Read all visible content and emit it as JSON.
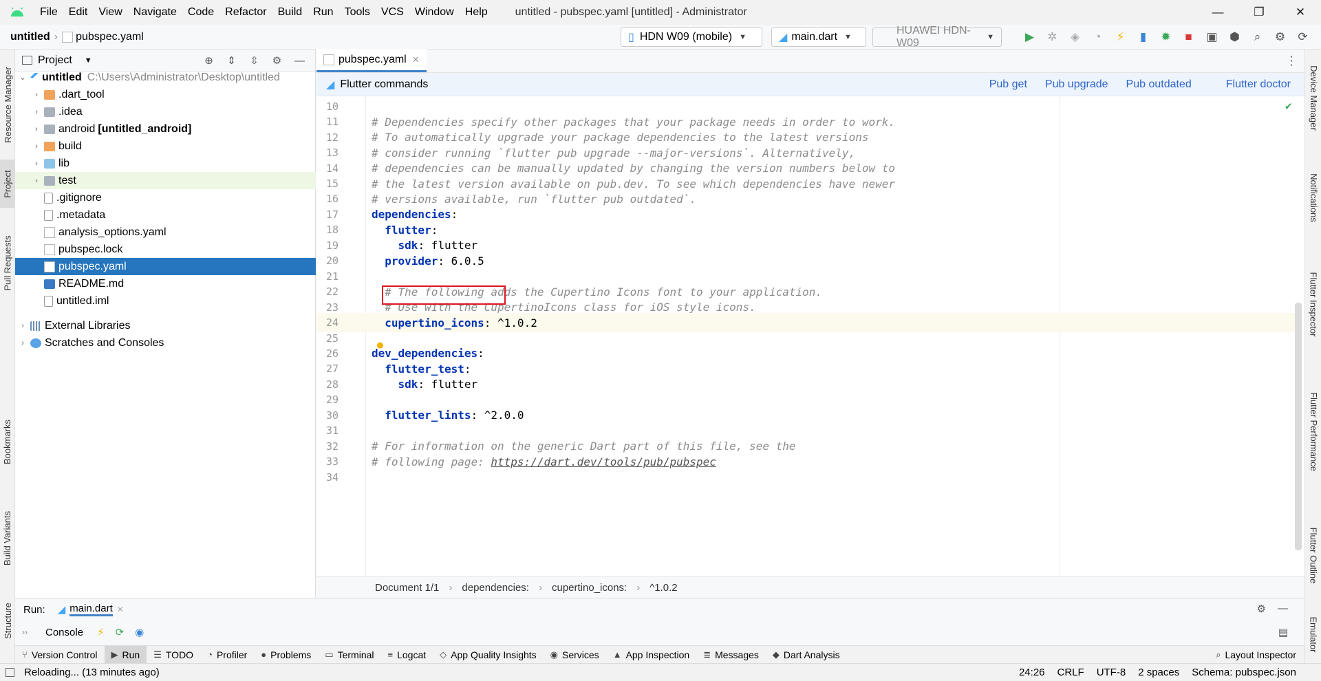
{
  "titlebar": {
    "menu": [
      "File",
      "Edit",
      "View",
      "Navigate",
      "Code",
      "Refactor",
      "Build",
      "Run",
      "Tools",
      "VCS",
      "Window",
      "Help"
    ],
    "window_title": "untitled - pubspec.yaml [untitled] - Administrator",
    "minimize": "—",
    "restore": "❐",
    "close": "✕"
  },
  "navbar": {
    "project": "untitled",
    "file": "pubspec.yaml",
    "device": "HDN W09 (mobile)",
    "run_config": "main.dart",
    "device2": "HUAWEI HDN-W09"
  },
  "project_panel": {
    "title": "Project",
    "root": {
      "name": "untitled",
      "path": "C:\\Users\\Administrator\\Desktop\\untitled"
    },
    "items": [
      {
        "name": ".dart_tool",
        "icon": "folder-orange",
        "chev": true
      },
      {
        "name": ".idea",
        "icon": "folder-gray",
        "chev": true
      },
      {
        "name": "android",
        "suffix": "[untitled_android]",
        "icon": "folder-gray",
        "chev": true
      },
      {
        "name": "build",
        "icon": "folder-orange",
        "chev": true
      },
      {
        "name": "lib",
        "icon": "folder-blue",
        "chev": true
      },
      {
        "name": "test",
        "icon": "folder-gray",
        "chev": true
      },
      {
        "name": ".gitignore",
        "icon": "file",
        "chev": false
      },
      {
        "name": ".metadata",
        "icon": "file",
        "chev": false
      },
      {
        "name": "analysis_options.yaml",
        "icon": "yml",
        "chev": false
      },
      {
        "name": "pubspec.lock",
        "icon": "yml",
        "chev": false
      },
      {
        "name": "pubspec.yaml",
        "icon": "yml",
        "chev": false
      },
      {
        "name": "README.md",
        "icon": "md",
        "chev": false
      },
      {
        "name": "untitled.iml",
        "icon": "file",
        "chev": false
      }
    ],
    "external": "External Libraries",
    "scratches": "Scratches and Consoles"
  },
  "editor": {
    "tab": "pubspec.yaml",
    "flutter_commands": "Flutter commands",
    "links": [
      "Pub get",
      "Pub upgrade",
      "Pub outdated",
      "Flutter doctor"
    ],
    "lines": [
      {
        "n": "10",
        "t": ""
      },
      {
        "n": "11",
        "t": "# Dependencies specify other packages that your package needs in order to work."
      },
      {
        "n": "12",
        "t": "# To automatically upgrade your package dependencies to the latest versions"
      },
      {
        "n": "13",
        "t": "# consider running `flutter pub upgrade --major-versions`. Alternatively,"
      },
      {
        "n": "14",
        "t": "# dependencies can be manually updated by changing the version numbers below to"
      },
      {
        "n": "15",
        "t": "# the latest version available on pub.dev. To see which dependencies have newer"
      },
      {
        "n": "16",
        "t": "# versions available, run `flutter pub outdated`."
      },
      {
        "n": "17",
        "k": "dependencies",
        "v": ":"
      },
      {
        "n": "18",
        "k": "  flutter",
        "v": ":"
      },
      {
        "n": "19",
        "k": "    sdk",
        "v": ": flutter"
      },
      {
        "n": "20",
        "k": "  provider",
        "v": ": 6.0.5"
      },
      {
        "n": "21",
        "t": ""
      },
      {
        "n": "22",
        "t": "  # The following adds the Cupertino Icons font to your application."
      },
      {
        "n": "23",
        "t": "  # Use with the CupertinoIcons class for iOS style icons."
      },
      {
        "n": "24",
        "k": "  cupertino_icons",
        "v": ": ^1.0.2"
      },
      {
        "n": "25",
        "t": ""
      },
      {
        "n": "26",
        "k": "dev_dependencies",
        "v": ":"
      },
      {
        "n": "27",
        "k": "  flutter_test",
        "v": ":"
      },
      {
        "n": "28",
        "k": "    sdk",
        "v": ": flutter"
      },
      {
        "n": "29",
        "t": ""
      },
      {
        "n": "30",
        "k": "  flutter_lints",
        "v": ": ^2.0.0"
      },
      {
        "n": "31",
        "t": ""
      },
      {
        "n": "32",
        "t": "# For information on the generic Dart part of this file, see the"
      },
      {
        "n": "33",
        "t": "# following page: ",
        "u": "https://dart.dev/tools/pub/pubspec"
      },
      {
        "n": "34",
        "t": ""
      }
    ],
    "breadcrumb": [
      "Document 1/1",
      "dependencies:",
      "cupertino_icons:",
      "^1.0.2"
    ]
  },
  "run_panel": {
    "label": "Run:",
    "tab": "main.dart",
    "console": "Console"
  },
  "tool_tabs": [
    "Version Control",
    "Run",
    "TODO",
    "Profiler",
    "Problems",
    "Terminal",
    "Logcat",
    "App Quality Insights",
    "Services",
    "App Inspection",
    "Messages",
    "Dart Analysis"
  ],
  "layout_inspector": "Layout Inspector",
  "left_strip": [
    "Resource Manager",
    "Project",
    "Pull Requests",
    "Bookmarks",
    "Build Variants",
    "Structure"
  ],
  "right_strip": [
    "Device Manager",
    "Notifications",
    "Flutter Inspector",
    "Flutter Performance",
    "Flutter Outline",
    "Emulator"
  ],
  "status": {
    "message": "Reloading... (13 minutes ago)",
    "position": "24:26",
    "line_sep": "CRLF",
    "encoding": "UTF-8",
    "indent": "2 spaces",
    "schema": "Schema: pubspec.json"
  },
  "colors": {
    "accent": "#2675bf",
    "highlight_box": "#e0141e",
    "keyword": "#0033b3"
  }
}
